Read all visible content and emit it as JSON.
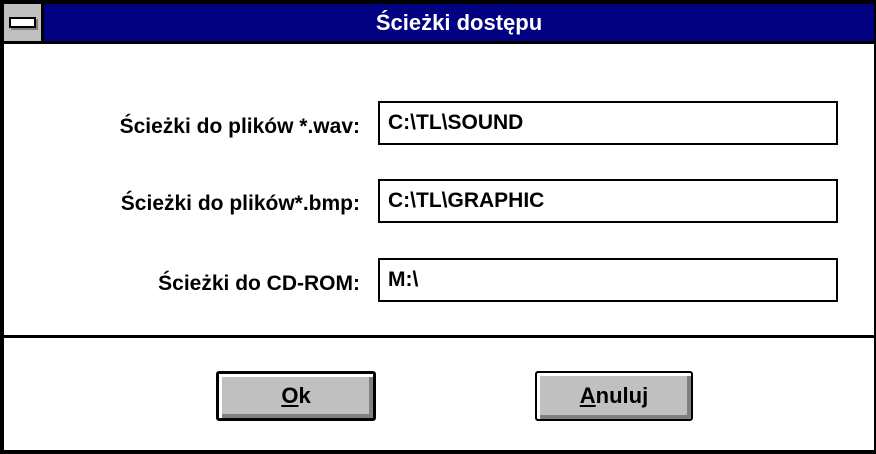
{
  "window": {
    "title": "Ścieżki dostępu",
    "system_menu_icon": "system-menu-icon"
  },
  "fields": [
    {
      "label": "Ścieżki do plików *.wav:",
      "value": "C:\\TL\\SOUND"
    },
    {
      "label": "Ścieżki do plików*.bmp:",
      "value": "C:\\TL\\GRAPHIC"
    },
    {
      "label": "Ścieżki do CD-ROM:",
      "value": "M:\\"
    }
  ],
  "buttons": {
    "ok": {
      "mnemonic": "O",
      "rest": "k"
    },
    "cancel": {
      "mnemonic": "A",
      "rest": "nuluj"
    }
  },
  "colors": {
    "titlebar": "#000080",
    "button_face": "#c0c0c0",
    "window_bg": "#ffffff"
  }
}
